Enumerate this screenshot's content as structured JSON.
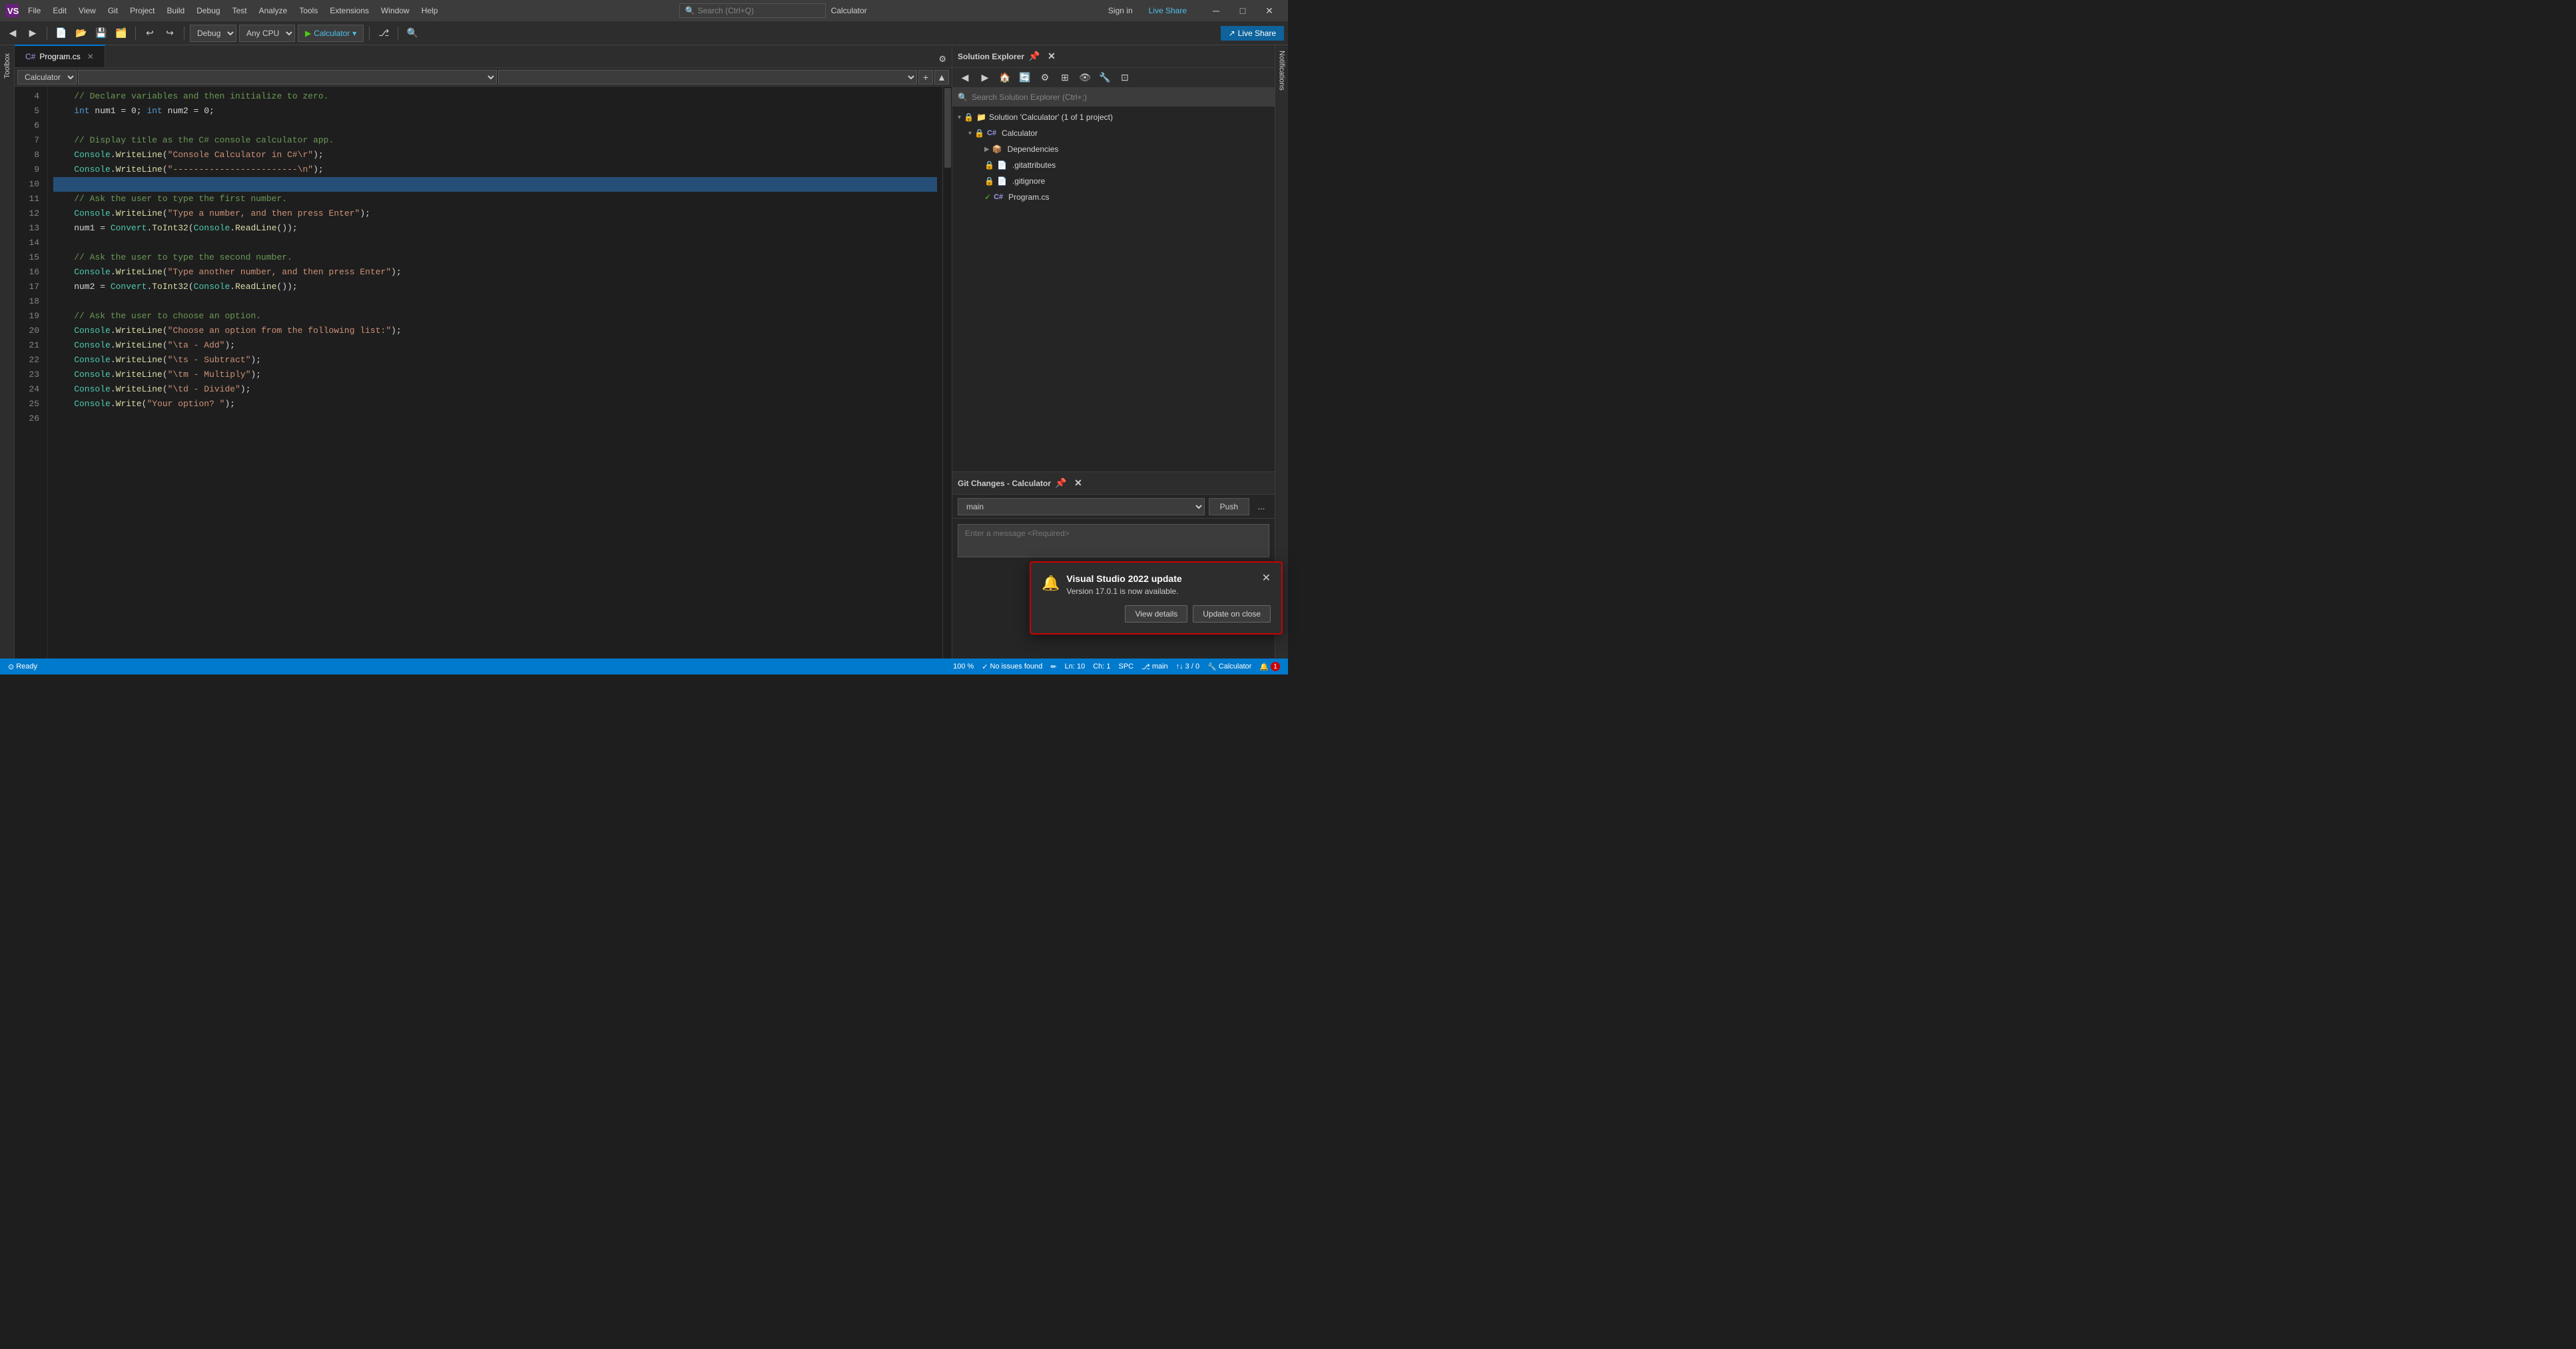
{
  "titleBar": {
    "appName": "Calculator",
    "signIn": "Sign in",
    "liveShare": "Live Share",
    "searchPlaceholder": "Search (Ctrl+Q)",
    "menuItems": [
      "File",
      "Edit",
      "View",
      "Git",
      "Project",
      "Build",
      "Debug",
      "Test",
      "Analyze",
      "Tools",
      "Extensions",
      "Window",
      "Help"
    ]
  },
  "toolbar": {
    "debugConfig": "Debug",
    "platform": "Any CPU",
    "runTarget": "Calculator",
    "liveShareLabel": "Live Share"
  },
  "editor": {
    "tabName": "Program.cs",
    "activeClass": "Calculator",
    "lines": [
      {
        "num": "4",
        "content": "    // Declare variables and then initialize to zero.",
        "type": "comment"
      },
      {
        "num": "5",
        "content": "    int num1 = 0; int num2 = 0;",
        "type": "code"
      },
      {
        "num": "6",
        "content": "",
        "type": "blank"
      },
      {
        "num": "7",
        "content": "    // Display title as the C# console calculator app.",
        "type": "comment"
      },
      {
        "num": "8",
        "content": "    Console.WriteLine(\"Console Calculator in C#\\r\");",
        "type": "code"
      },
      {
        "num": "9",
        "content": "    Console.WriteLine(\"------------------------\\n\");",
        "type": "code"
      },
      {
        "num": "10",
        "content": "",
        "type": "highlighted"
      },
      {
        "num": "11",
        "content": "    // Ask the user to type the first number.",
        "type": "comment"
      },
      {
        "num": "12",
        "content": "    Console.WriteLine(\"Type a number, and then press Enter\");",
        "type": "code"
      },
      {
        "num": "13",
        "content": "    num1 = Convert.ToInt32(Console.ReadLine());",
        "type": "code"
      },
      {
        "num": "14",
        "content": "",
        "type": "blank"
      },
      {
        "num": "15",
        "content": "    // Ask the user to type the second number.",
        "type": "comment"
      },
      {
        "num": "16",
        "content": "    Console.WriteLine(\"Type another number, and then press Enter\");",
        "type": "code"
      },
      {
        "num": "17",
        "content": "    num2 = Convert.ToInt32(Console.ReadLine());",
        "type": "code"
      },
      {
        "num": "18",
        "content": "",
        "type": "blank"
      },
      {
        "num": "19",
        "content": "    // Ask the user to choose an option.",
        "type": "comment"
      },
      {
        "num": "20",
        "content": "    Console.WriteLine(\"Choose an option from the following list:\");",
        "type": "code"
      },
      {
        "num": "21",
        "content": "    Console.WriteLine(\"\\ta - Add\");",
        "type": "code"
      },
      {
        "num": "22",
        "content": "    Console.WriteLine(\"\\ts - Subtract\");",
        "type": "code"
      },
      {
        "num": "23",
        "content": "    Console.WriteLine(\"\\tm - Multiply\");",
        "type": "code"
      },
      {
        "num": "24",
        "content": "    Console.WriteLine(\"\\td - Divide\");",
        "type": "code"
      },
      {
        "num": "25",
        "content": "    Console.Write(\"Your option? \");",
        "type": "code"
      },
      {
        "num": "26",
        "content": "",
        "type": "blank"
      }
    ]
  },
  "solutionExplorer": {
    "title": "Solution Explorer",
    "searchPlaceholder": "Search Solution Explorer (Ctrl+;)",
    "tree": [
      {
        "label": "Solution 'Calculator' (1 of 1 project)",
        "depth": 0,
        "icon": "📁",
        "hasLock": true
      },
      {
        "label": "Calculator",
        "depth": 1,
        "icon": "⚙️",
        "hasLock": true
      },
      {
        "label": "Dependencies",
        "depth": 2,
        "icon": "📦",
        "expanded": false
      },
      {
        "label": ".gitattributes",
        "depth": 2,
        "icon": "📄",
        "hasLock": true
      },
      {
        "label": ".gitignore",
        "depth": 2,
        "icon": "📄",
        "hasLock": true
      },
      {
        "label": "Program.cs",
        "depth": 2,
        "icon": "C#",
        "hasCheck": true
      }
    ]
  },
  "gitChanges": {
    "title": "Git Changes - Calculator",
    "branch": "main",
    "pushLabel": "Push",
    "moreLabel": "...",
    "commitPlaceholder": "Enter a message <Required>"
  },
  "notification": {
    "title": "Visual Studio 2022 update",
    "body": "Version 17.0.1 is now available.",
    "viewDetailsLabel": "View details",
    "updateOnCloseLabel": "Update on close"
  },
  "statusBar": {
    "ready": "Ready",
    "issuesLabel": "No issues found",
    "lineInfo": "Ln: 10",
    "colInfo": "Ch: 1",
    "encoding": "SPC",
    "zoom": "100 %",
    "gitBranch": "main",
    "projectName": "Calculator",
    "changes": "3 / 0",
    "pencilCount": "1"
  }
}
